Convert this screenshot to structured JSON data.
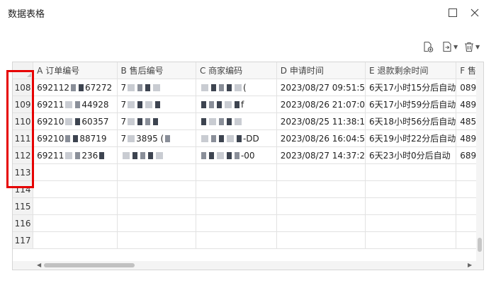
{
  "window": {
    "title": "数据表格"
  },
  "toolbar": {
    "add_icon": "add-file-icon",
    "export_icon": "export-icon",
    "delete_icon": "trash-icon"
  },
  "columns": [
    {
      "letter": "A",
      "label": "订单编号"
    },
    {
      "letter": "B",
      "label": "售后编号"
    },
    {
      "letter": "C",
      "label": "商家编码"
    },
    {
      "letter": "D",
      "label": "申请时间"
    },
    {
      "letter": "E",
      "label": "退款剩余时间"
    },
    {
      "letter": "F",
      "label": "售"
    }
  ],
  "rows": [
    {
      "num": "108",
      "a_pre": "692112",
      "a_post": "67272",
      "b": "7",
      "c_end": "(",
      "d": "2023/08/27 09:51:5",
      "e": "6天17小时15分后自动",
      "f": "089"
    },
    {
      "num": "109",
      "a_pre": "69211",
      "a_post": "44928",
      "b": "7",
      "c_end": "f",
      "d": "2023/08/26 21:07:0",
      "e": "6天17小时59分后自动",
      "f": "489"
    },
    {
      "num": "110",
      "a_pre": "69210",
      "a_post": "60357",
      "b": "7",
      "c_end": "",
      "d": "2023/08/25 11:38:1",
      "e": "6天18小时56分后自动",
      "f": "485"
    },
    {
      "num": "111",
      "a_pre": "69210",
      "a_post": "88719",
      "b": "7",
      "b_mid": "3895 (",
      "c_end": "-DD",
      "d": "2023/08/26 16:04:5",
      "e": "6天19小时22分后自动",
      "f": "489"
    },
    {
      "num": "112",
      "a_pre": "69211",
      "a_post": "236",
      "b": "",
      "c_end": "-00",
      "d": "2023/08/27 14:37:2",
      "e": "6天23小时0分后自动",
      "f": "689"
    },
    {
      "num": "113"
    },
    {
      "num": "114"
    },
    {
      "num": "115"
    },
    {
      "num": "116"
    },
    {
      "num": "117"
    }
  ]
}
